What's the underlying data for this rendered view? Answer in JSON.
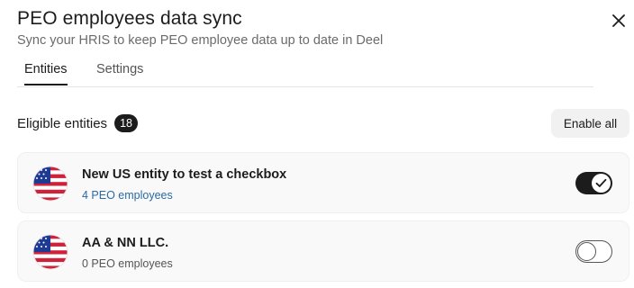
{
  "dialog": {
    "title": "PEO employees data sync",
    "subtitle": "Sync your HRIS to keep PEO employee data up to date in Deel"
  },
  "tabs": [
    {
      "label": "Entities",
      "active": true
    },
    {
      "label": "Settings",
      "active": false
    }
  ],
  "section": {
    "title": "Eligible entities",
    "count": "18",
    "enable_all_label": "Enable all"
  },
  "entities": [
    {
      "name": "New US entity to test a checkbox",
      "employees": "4 PEO employees",
      "enabled": true,
      "flag": "us-flag-icon"
    },
    {
      "name": "AA & NN LLC.",
      "employees": "0 PEO employees",
      "enabled": false,
      "flag": "us-flag-icon"
    }
  ],
  "colors": {
    "text": "#1c1c1c",
    "muted": "#6b6b6b",
    "link": "#2b6aa3",
    "card_bg": "#f9f9f9",
    "button_bg": "#f1f1f1"
  }
}
